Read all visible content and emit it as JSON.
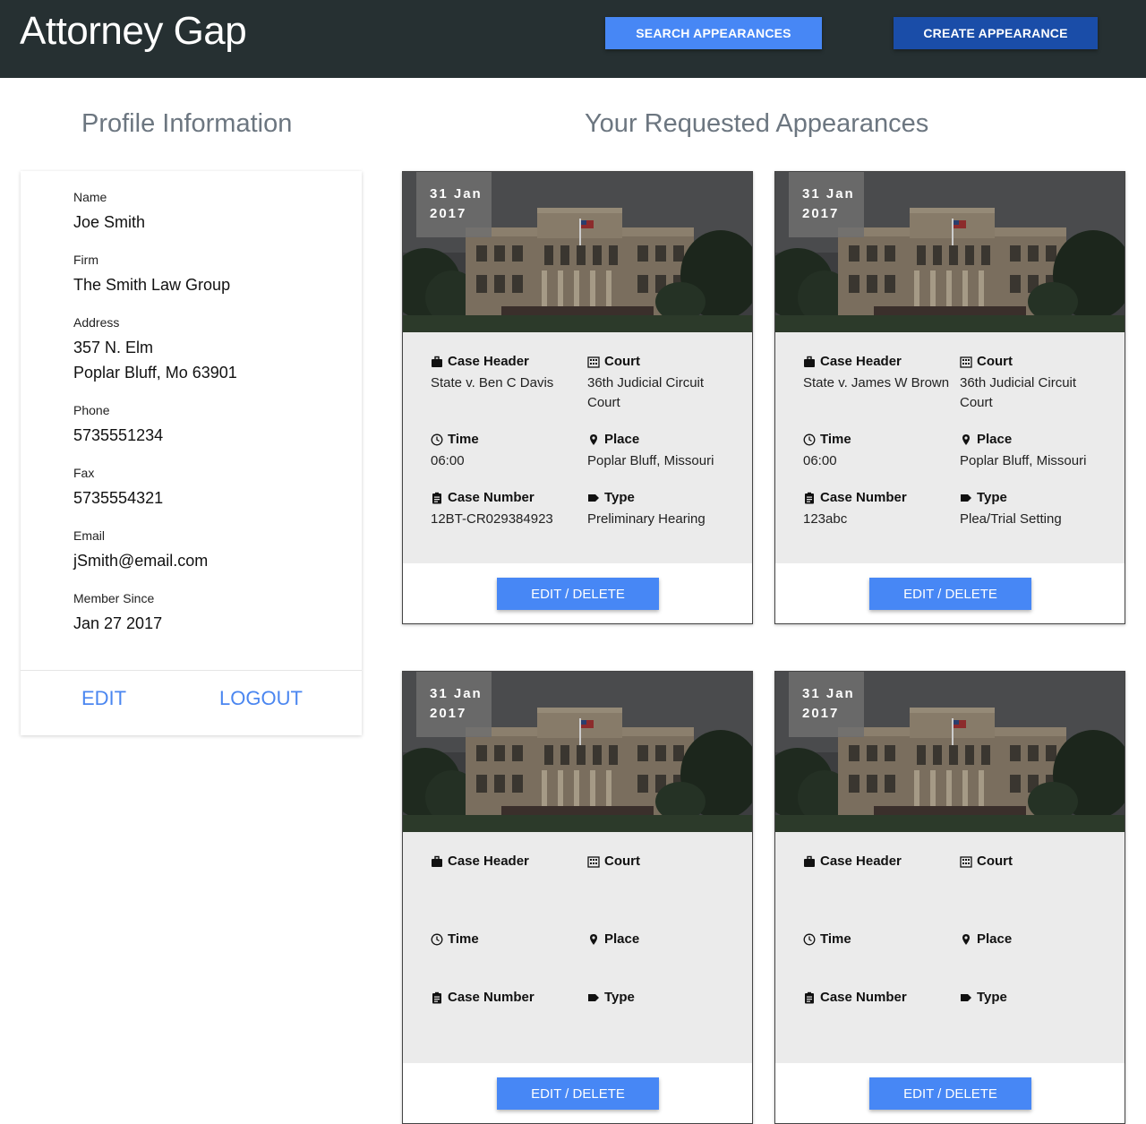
{
  "header": {
    "brand": "Attorney Gap",
    "search_label": "Search Appearances",
    "create_label": "Create Appearance",
    "colors": {
      "bar": "#263032",
      "search": "#4787f5",
      "create": "#1a4da8"
    }
  },
  "profile": {
    "title": "Profile Information",
    "name_label": "Name",
    "name": "Joe Smith",
    "firm_label": "Firm",
    "firm": "The Smith Law Group",
    "address_label": "Address",
    "address_line1": "357 N. Elm",
    "address_line2": "Poplar Bluff, Mo 63901",
    "phone_label": "Phone",
    "phone": "5735551234",
    "fax_label": "Fax",
    "fax": "5735554321",
    "email_label": "Email",
    "email": "jSmith@email.com",
    "member_label": "Member Since",
    "member_since": "Jan 27 2017",
    "edit_label": "Edit",
    "logout_label": "Logout"
  },
  "appearances": {
    "title": "Your Requested Appearances",
    "labels": {
      "case_header": "Case Header",
      "court": "Court",
      "time": "Time",
      "place": "Place",
      "case_number": "Case Number",
      "type": "Type",
      "edit_delete": "Edit / Delete"
    },
    "cards": [
      {
        "date_day": "31 Jan",
        "date_year": "2017",
        "case_header": "State v. Ben C Davis",
        "court": "36th Judicial Circuit Court",
        "time": "06:00",
        "place": "Poplar Bluff, Missouri",
        "case_number": "12BT-CR029384923",
        "type": "Preliminary Hearing"
      },
      {
        "date_day": "31 Jan",
        "date_year": "2017",
        "case_header": "State v. James W Brown",
        "court": "36th Judicial Circuit Court",
        "time": "06:00",
        "place": "Poplar Bluff, Missouri",
        "case_number": "123abc",
        "type": "Plea/Trial Setting"
      },
      {
        "date_day": "31 Jan",
        "date_year": "2017"
      },
      {
        "date_day": "31 Jan",
        "date_year": "2017"
      }
    ]
  }
}
